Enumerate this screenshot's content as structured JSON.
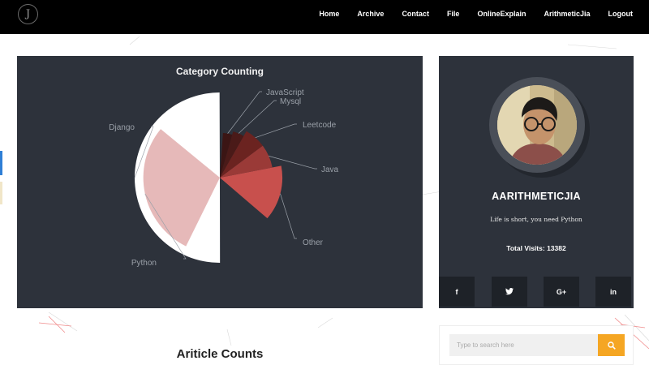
{
  "logo": {
    "glyph": "J"
  },
  "nav": {
    "items": [
      "Home",
      "Archive",
      "Contact",
      "File",
      "OnlineExplain",
      "ArithmeticJia",
      "Logout"
    ]
  },
  "chart_data": {
    "type": "pie",
    "title": "Category Counting",
    "slices": [
      {
        "name": "Django",
        "value": 25,
        "color": "#ffffff"
      },
      {
        "name": "Python",
        "value": 19,
        "color": "#e6b9b9"
      },
      {
        "name": "Other",
        "value": 11,
        "color": "#c8504d"
      },
      {
        "name": "Java",
        "value": 7,
        "color": "#9a3a37"
      },
      {
        "name": "Leetcode",
        "value": 7,
        "color": "#6b2320"
      },
      {
        "name": "Mysql",
        "value": 5,
        "color": "#4a1a18"
      },
      {
        "name": "JavaScript",
        "value": 4,
        "color": "#3b1514"
      }
    ],
    "label_color": "#9aa0a8",
    "background": "#2d323b"
  },
  "profile": {
    "name": "AARITHMETICJIA",
    "motto": "Life is short, you need Python",
    "visits_label": "Total Visits:",
    "visits_value": "13382",
    "socials": [
      "f",
      "✉",
      "G+",
      "in"
    ]
  },
  "search": {
    "placeholder": "Type to search here"
  },
  "section": {
    "title": "Ariticle Counts"
  },
  "colors": {
    "accent": "#f5a623",
    "panel": "#2d323b",
    "navbar": "#000000"
  }
}
